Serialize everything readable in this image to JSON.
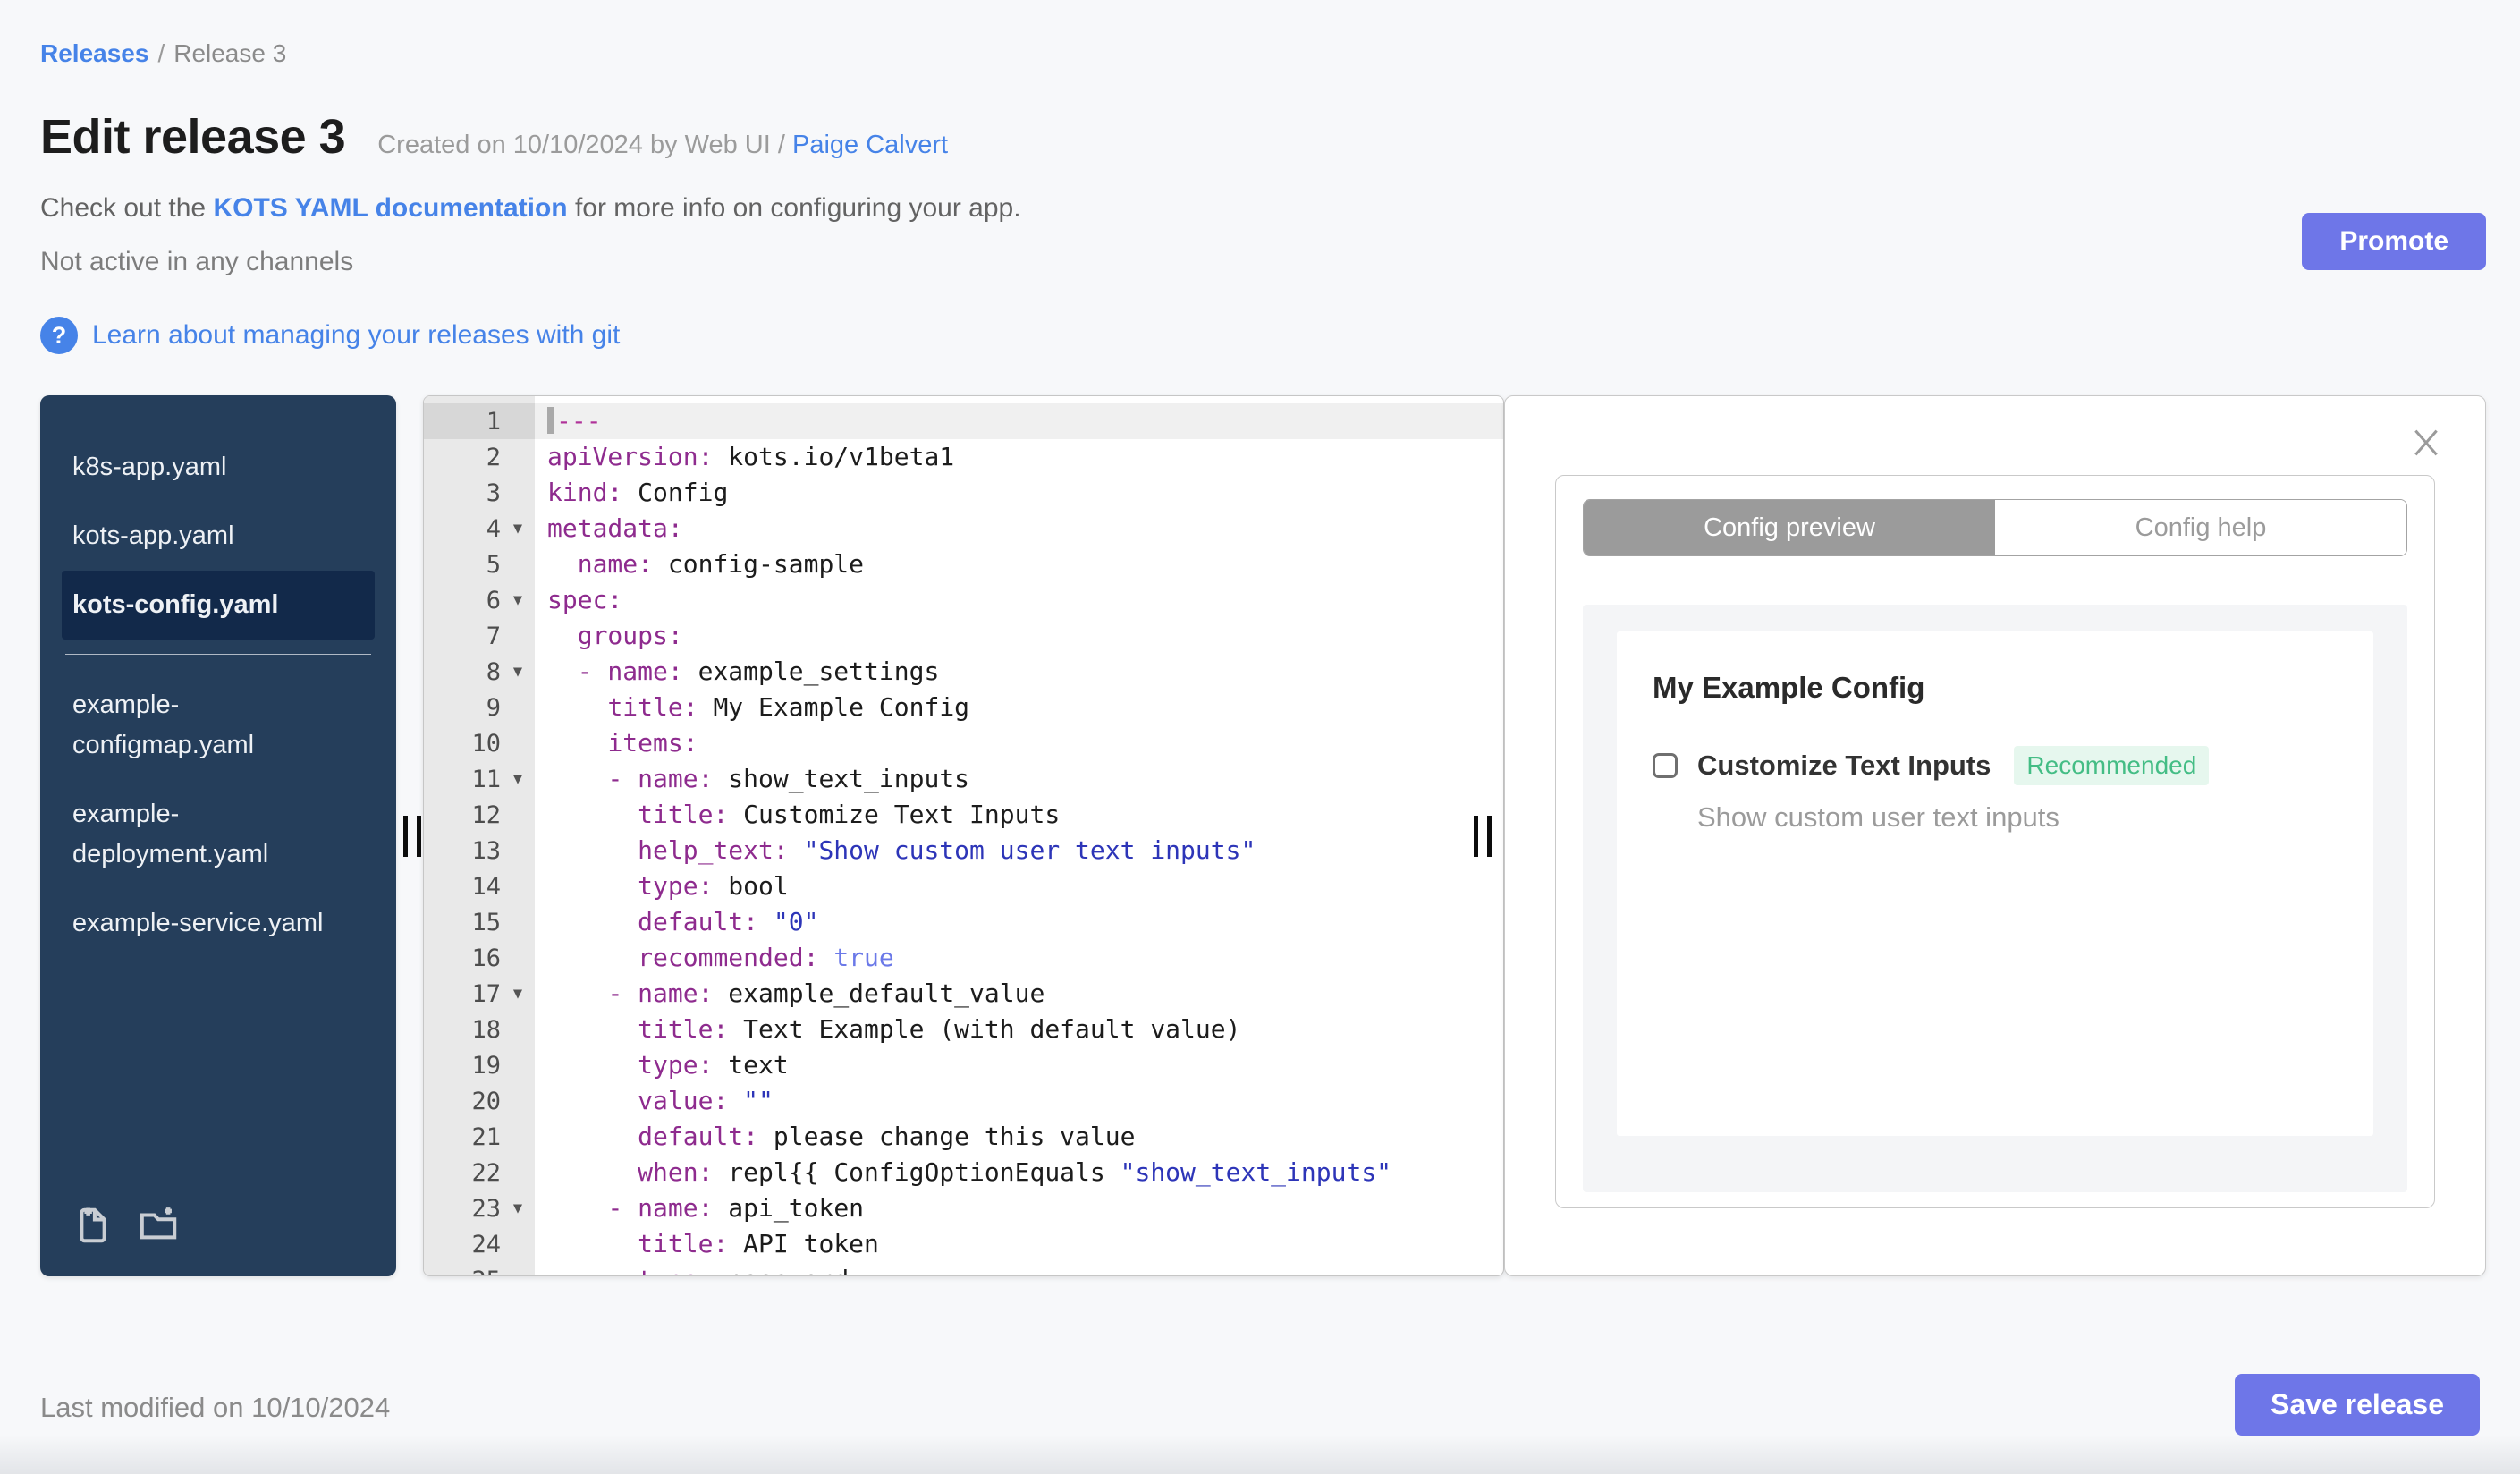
{
  "breadcrumb": {
    "link": "Releases",
    "separator": "/",
    "current": "Release 3"
  },
  "header": {
    "title": "Edit release 3",
    "created_prefix": "Created on 10/10/2024 by Web UI / ",
    "created_author": "Paige Calvert",
    "doc_prefix": "Check out the ",
    "doc_link": "KOTS YAML documentation",
    "doc_suffix": " for more info on configuring your app.",
    "channel_status": "Not active in any channels",
    "git_link": "Learn about managing your releases with git",
    "promote_label": "Promote",
    "help_icon_glyph": "?"
  },
  "file_tree": {
    "groups": [
      {
        "files": [
          "k8s-app.yaml",
          "kots-app.yaml",
          "kots-config.yaml"
        ]
      },
      {
        "files": [
          "example-configmap.yaml",
          "example-deployment.yaml",
          "example-service.yaml"
        ]
      }
    ],
    "selected": "kots-config.yaml",
    "actions": [
      "add-file",
      "add-folder"
    ]
  },
  "editor": {
    "fold_lines": [
      4,
      6,
      8,
      11,
      17,
      23
    ],
    "active_line": 1,
    "lines": [
      [
        [
          "doc",
          "---"
        ]
      ],
      [
        [
          "key",
          "apiVersion:"
        ],
        [
          "pl",
          " kots.io/v1beta1"
        ]
      ],
      [
        [
          "key",
          "kind:"
        ],
        [
          "pl",
          " Config"
        ]
      ],
      [
        [
          "key",
          "metadata:"
        ]
      ],
      [
        [
          "pl",
          "  "
        ],
        [
          "key",
          "name:"
        ],
        [
          "pl",
          " config-sample"
        ]
      ],
      [
        [
          "key",
          "spec:"
        ]
      ],
      [
        [
          "pl",
          "  "
        ],
        [
          "key",
          "groups:"
        ]
      ],
      [
        [
          "pl",
          "  "
        ],
        [
          "key",
          "- name:"
        ],
        [
          "pl",
          " example_settings"
        ]
      ],
      [
        [
          "pl",
          "    "
        ],
        [
          "key",
          "title:"
        ],
        [
          "pl",
          " My Example Config"
        ]
      ],
      [
        [
          "pl",
          "    "
        ],
        [
          "key",
          "items:"
        ]
      ],
      [
        [
          "pl",
          "    "
        ],
        [
          "key",
          "- name:"
        ],
        [
          "pl",
          " show_text_inputs"
        ]
      ],
      [
        [
          "pl",
          "      "
        ],
        [
          "key",
          "title:"
        ],
        [
          "pl",
          " Customize Text Inputs"
        ]
      ],
      [
        [
          "pl",
          "      "
        ],
        [
          "key",
          "help_text:"
        ],
        [
          "pl",
          " "
        ],
        [
          "str",
          "\"Show custom user text inputs\""
        ]
      ],
      [
        [
          "pl",
          "      "
        ],
        [
          "key",
          "type:"
        ],
        [
          "pl",
          " bool"
        ]
      ],
      [
        [
          "pl",
          "      "
        ],
        [
          "key",
          "default:"
        ],
        [
          "pl",
          " "
        ],
        [
          "str",
          "\"0\""
        ]
      ],
      [
        [
          "pl",
          "      "
        ],
        [
          "key",
          "recommended:"
        ],
        [
          "pl",
          " "
        ],
        [
          "bool",
          "true"
        ]
      ],
      [
        [
          "pl",
          "    "
        ],
        [
          "key",
          "- name:"
        ],
        [
          "pl",
          " example_default_value"
        ]
      ],
      [
        [
          "pl",
          "      "
        ],
        [
          "key",
          "title:"
        ],
        [
          "pl",
          " Text Example (with default value)"
        ]
      ],
      [
        [
          "pl",
          "      "
        ],
        [
          "key",
          "type:"
        ],
        [
          "pl",
          " text"
        ]
      ],
      [
        [
          "pl",
          "      "
        ],
        [
          "key",
          "value:"
        ],
        [
          "pl",
          " "
        ],
        [
          "str",
          "\"\""
        ]
      ],
      [
        [
          "pl",
          "      "
        ],
        [
          "key",
          "default:"
        ],
        [
          "pl",
          " please change this value"
        ]
      ],
      [
        [
          "pl",
          "      "
        ],
        [
          "key",
          "when:"
        ],
        [
          "pl",
          " repl{{ ConfigOptionEquals "
        ],
        [
          "str",
          "\"show_text_inputs\""
        ]
      ],
      [
        [
          "pl",
          "    "
        ],
        [
          "key",
          "- name:"
        ],
        [
          "pl",
          " api_token"
        ]
      ],
      [
        [
          "pl",
          "      "
        ],
        [
          "key",
          "title:"
        ],
        [
          "pl",
          " API token"
        ]
      ],
      [
        [
          "pl",
          "      "
        ],
        [
          "key",
          "type:"
        ],
        [
          "pl",
          " password"
        ]
      ]
    ]
  },
  "preview": {
    "tabs": [
      {
        "label": "Config preview",
        "active": true
      },
      {
        "label": "Config help",
        "active": false
      }
    ],
    "group_title": "My Example Config",
    "item_label": "Customize Text Inputs",
    "badge": "Recommended",
    "item_help": "Show custom user text inputs",
    "checkbox_checked": false
  },
  "footer": {
    "last_modified": "Last modified on 10/10/2024",
    "save_label": "Save release"
  },
  "colors": {
    "accent_link": "#4683e8",
    "primary_button": "#6e76e8",
    "sidebar_bg": "#253e5b",
    "sidebar_selected_bg": "#12294a",
    "badge_green_text": "#44bd85",
    "badge_green_bg": "#e6f7ee",
    "syntax_key": "#8e2b8e",
    "syntax_string": "#2d35b8",
    "syntax_bool": "#6b79e8",
    "tab_active_bg": "#9b9b9b"
  }
}
